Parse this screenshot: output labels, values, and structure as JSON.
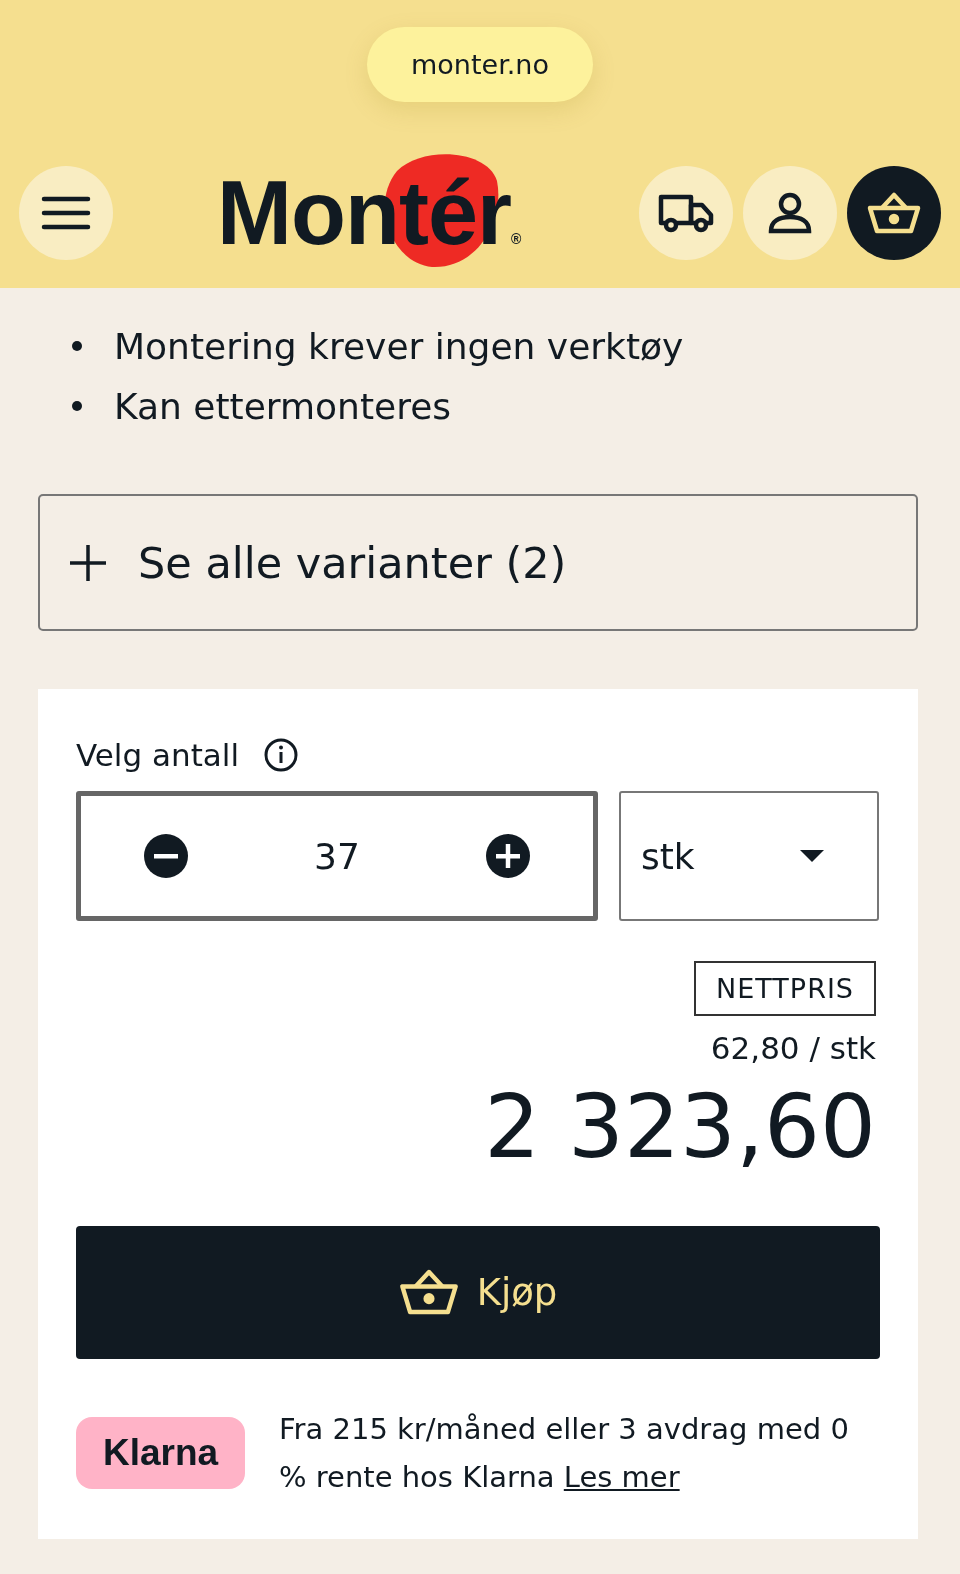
{
  "browser": {
    "url": "monter.no"
  },
  "header": {
    "logo": "Montér",
    "logo_mark": "®"
  },
  "features": [
    "Montering krever ingen verktøy",
    "Kan ettermonteres"
  ],
  "variants": {
    "label": "Se alle varianter (2)"
  },
  "purchase": {
    "quantity_label": "Velg antall",
    "quantity": "37",
    "unit": "stk",
    "price_badge": "NETTPRIS",
    "unit_price": "62,80 / stk",
    "total": "2 323,60",
    "buy_label": "Kjøp"
  },
  "klarna": {
    "badge": "Klarna",
    "text": "Fra 215 kr/måned eller 3 avdrag med 0 % rente hos Klarna",
    "link": "Les mer"
  }
}
